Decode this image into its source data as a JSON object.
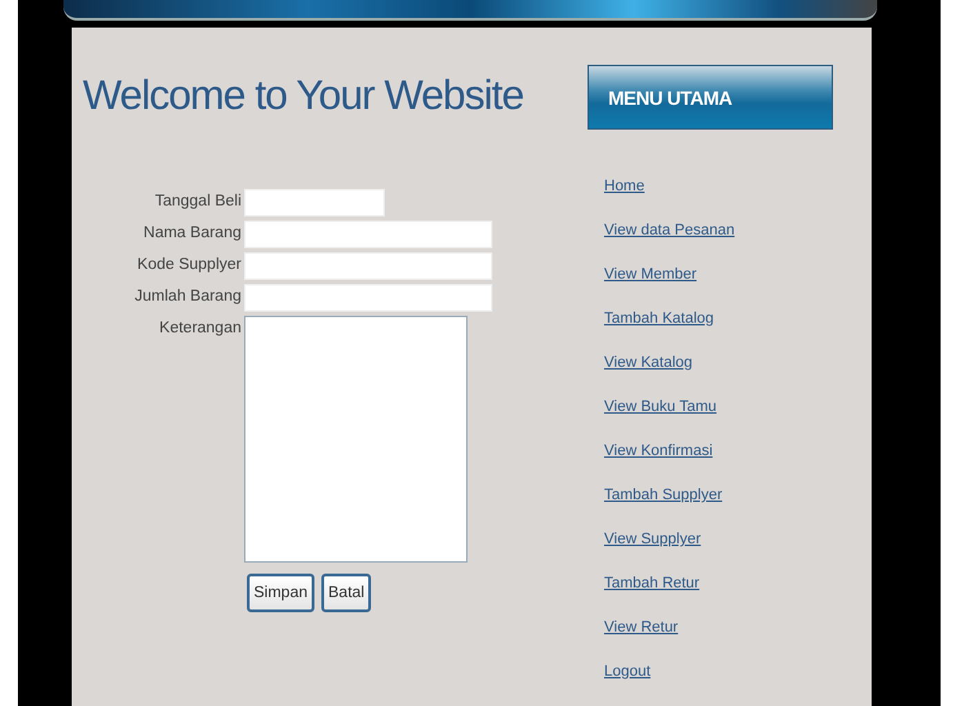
{
  "header": {
    "title": "Welcome to Your Website"
  },
  "form": {
    "fields": [
      {
        "label": "Tanggal Beli",
        "kind": "short"
      },
      {
        "label": "Nama Barang",
        "kind": "text"
      },
      {
        "label": "Kode Supplyer",
        "kind": "text"
      },
      {
        "label": "Jumlah Barang",
        "kind": "text"
      },
      {
        "label": "Keterangan",
        "kind": "textarea"
      }
    ],
    "buttons": [
      "Simpan",
      "Batal"
    ]
  },
  "menu": {
    "title": "MENU UTAMA",
    "links": [
      "Home",
      "View data Pesanan",
      "View Member",
      "Tambah Katalog",
      "View Katalog",
      "View Buku Tamu",
      "View Konfirmasi",
      "Tambah Supplyer",
      "View Supplyer",
      "Tambah Retur",
      "View Retur",
      "Logout"
    ]
  }
}
